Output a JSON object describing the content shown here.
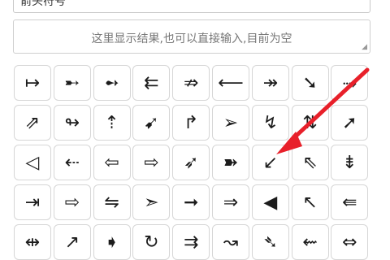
{
  "search_input": {
    "value": "箭头符号"
  },
  "result": {
    "placeholder": "这里显示结果,也可以直接输入,目前为空"
  },
  "symbols": [
    "↦",
    "➸",
    "➻",
    "⇇",
    "⇏",
    "⟵",
    "↠",
    "➘",
    "⤑",
    "⇗",
    "↬",
    "⇡",
    "➹",
    "↱",
    "➢",
    "↯",
    "⇅",
    "➚",
    "◁",
    "⇠",
    "⇦",
    "⇨",
    "➶",
    "➽",
    "↙",
    "⇖",
    "⇟",
    "⇥",
    "⇨",
    "⇋",
    "➣",
    "➞",
    "⇒",
    "◀",
    "↖",
    "⇚",
    "⇹",
    "↗",
    "➧",
    "↻",
    "⇉",
    "↝",
    "➴",
    "⇜",
    "⇔"
  ],
  "annotation_color": "#e8202a"
}
